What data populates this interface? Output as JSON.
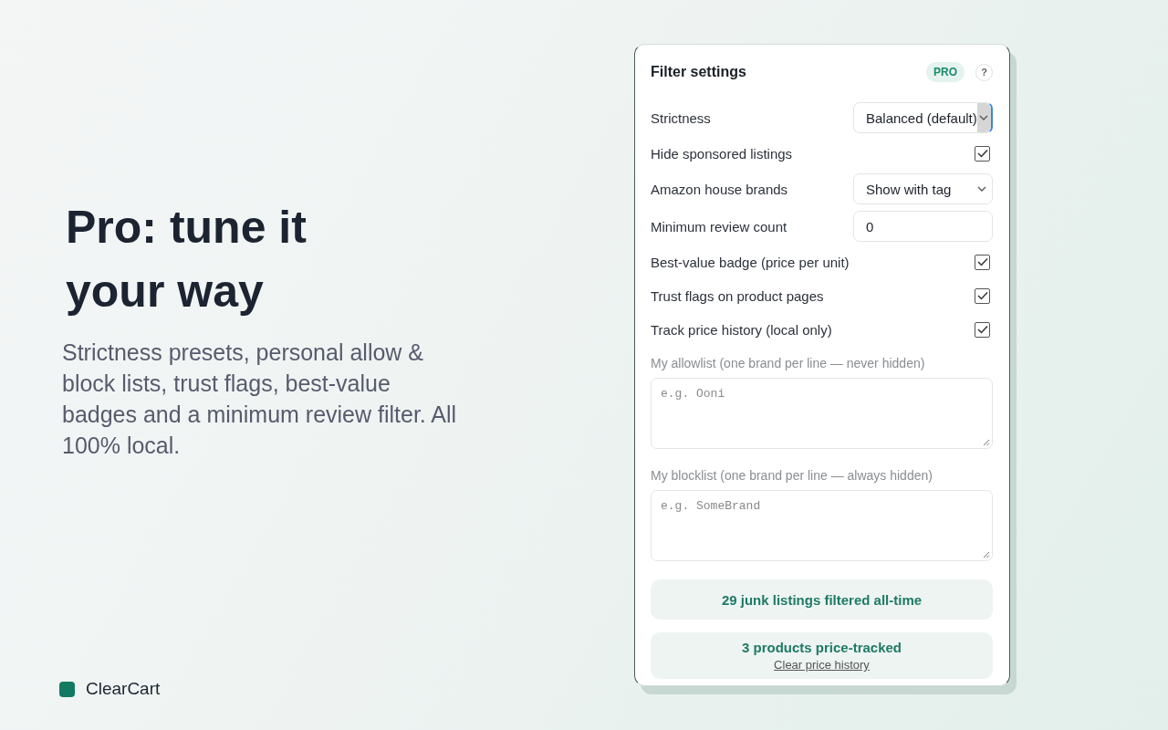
{
  "hero": {
    "title": "Pro: tune it your way",
    "description": "Strictness presets, personal allow & block lists, trust flags, best-value badges and a minimum review filter. All 100% local."
  },
  "brand": {
    "name": "ClearCart"
  },
  "panel": {
    "title": "Filter settings",
    "badge": "PRO",
    "help": "?",
    "settings": [
      {
        "kind": "select",
        "label": "Strictness",
        "value": "Balanced (default)",
        "focused": true
      },
      {
        "kind": "checkbox",
        "label": "Hide sponsored listings",
        "checked": true
      },
      {
        "kind": "select",
        "label": "Amazon house brands",
        "value": "Show with tag",
        "focused": false
      },
      {
        "kind": "number",
        "label": "Minimum review count",
        "value": "0"
      },
      {
        "kind": "checkbox",
        "label": "Best-value badge (price per unit)",
        "checked": true
      },
      {
        "kind": "checkbox",
        "label": "Trust flags on product pages",
        "checked": true
      },
      {
        "kind": "checkbox",
        "label": "Track price history (local only)",
        "checked": true
      }
    ],
    "lists": [
      {
        "label": "My allowlist (one brand per line — never hidden)",
        "placeholder": "e.g. Ooni"
      },
      {
        "label": "My blocklist (one brand per line — always hidden)",
        "placeholder": "e.g. SomeBrand"
      }
    ],
    "stats": [
      {
        "text": "29 junk listings filtered all-time"
      },
      {
        "text": "3 products price-tracked",
        "link": "Clear price history"
      }
    ]
  }
}
